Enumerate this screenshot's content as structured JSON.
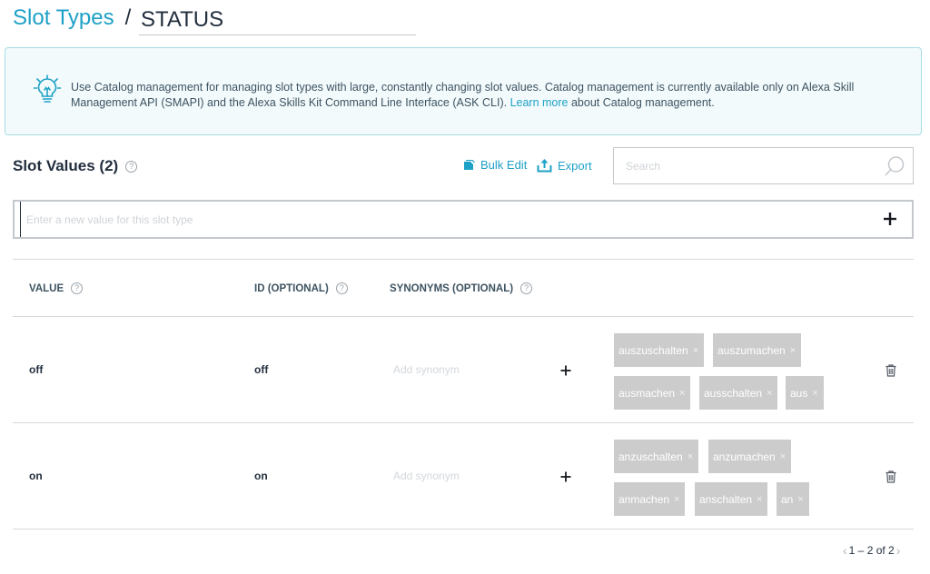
{
  "header": {
    "breadcrumb_link": "Slot Types",
    "separator": "/",
    "slot_type_name": "STATUS"
  },
  "info": {
    "text_before_link": "Use Catalog management for managing slot types with large, constantly changing slot values. Catalog management is currently available only on Alexa Skill Management API (SMAPI) and the Alexa Skills Kit Command Line Interface (ASK CLI). ",
    "link": "Learn more",
    "text_after_link": " about Catalog management."
  },
  "slot_values": {
    "title": "Slot Values (2)",
    "help": "?",
    "bulk_edit": "Bulk Edit",
    "export": "Export",
    "search_placeholder": "Search",
    "new_value_placeholder": "Enter a new value for this slot type"
  },
  "table": {
    "columns": [
      "VALUE",
      "ID (OPTIONAL)",
      "SYNONYMS (OPTIONAL)"
    ],
    "synonym_placeholder": "Add synonym",
    "tag_remove": "×",
    "rows": [
      {
        "value": "off",
        "id": "off",
        "synonyms": [
          "auszuschalten",
          "auszumachen",
          "ausmachen",
          "ausschalten",
          "aus"
        ]
      },
      {
        "value": "on",
        "id": "on",
        "synonyms": [
          "anzuschalten",
          "anzumachen",
          "anmachen",
          "anschalten",
          "an"
        ]
      }
    ]
  },
  "pager": {
    "prev": "‹",
    "label": "1 – 2 of 2",
    "next": "›"
  },
  "colors": {
    "accent": "#1ea1c6",
    "text": "#232f3e",
    "tag_bg": "#cccccc",
    "info_bg": "#f2fafc",
    "info_border": "#a8dde3"
  },
  "icons": {
    "info": "lightbulb-icon",
    "bulk_edit": "bulk-edit-icon",
    "export": "export-icon",
    "search": "search-icon",
    "add": "plus-icon",
    "delete": "trash-icon"
  }
}
